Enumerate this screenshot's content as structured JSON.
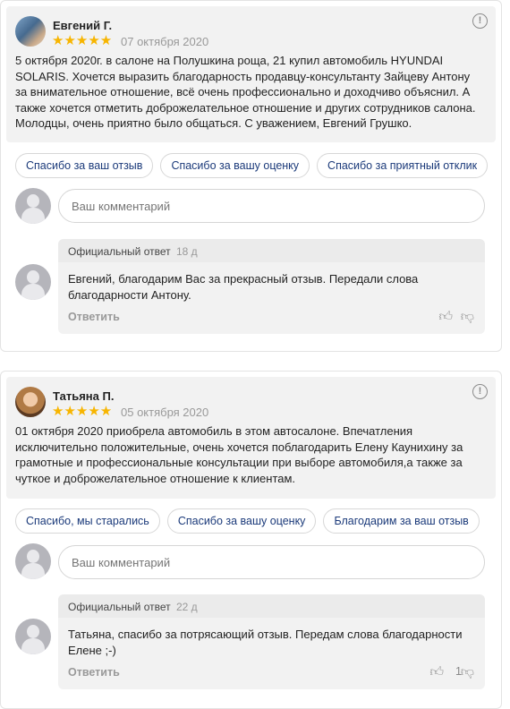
{
  "reviews": [
    {
      "author": "Евгений Г.",
      "rating": 5,
      "stars": "★★★★★",
      "date": "07 октября 2020",
      "text": "5 октября 2020г. в салоне на Полушкина роща, 21 купил автомобиль HYUNDAI SOLARIS. Хочется выразить благодарность продавцу-консультанту Зайцеву Антону за внимательное отношение, всё очень профессионально и доходчиво объяснил. А также хочется отметить доброжелательное отношение и других сотрудников салона. Молодцы, очень приятно было общаться. С уважением, Евгений Грушко.",
      "quick_replies": [
        "Спасибо за ваш отзыв",
        "Спасибо за вашу оценку",
        "Спасибо за приятный отклик"
      ],
      "comment_placeholder": "Ваш комментарий",
      "official_reply": {
        "title": "Официальный ответ",
        "age": "18 д",
        "text": "Евгений, благодарим Вас за прекрасный отзыв. Передали слова благодарности Антону.",
        "reply_label": "Ответить",
        "likes": ""
      }
    },
    {
      "author": "Татьяна П.",
      "rating": 5,
      "stars": "★★★★★",
      "date": "05 октября 2020",
      "text": "01 октября 2020 приобрела автомобиль в этом автосалоне. Впечатления исключительно положительные, очень хочется поблагодарить Елену Каунихину за грамотные и профессиональные консультации при выборе автомобиля,а также за чуткое и доброжелательное отношение к клиентам.",
      "quick_replies": [
        "Спасибо, мы старались",
        "Спасибо за вашу оценку",
        "Благодарим за ваш отзыв"
      ],
      "comment_placeholder": "Ваш комментарий",
      "official_reply": {
        "title": "Официальный ответ",
        "age": "22 д",
        "text": "Татьяна, спасибо за потрясающий отзыв. Передам слова благодарности Елене ;-)",
        "reply_label": "Ответить",
        "likes": "1"
      }
    }
  ],
  "icons": {
    "alert": "alert-icon",
    "thumb_up": "thumb-up-icon",
    "thumb_down": "thumb-down-icon",
    "user": "user-placeholder-icon",
    "star": "star-icon"
  },
  "colors": {
    "star": "#f7b500",
    "chip_text": "#1b3a7a",
    "panel_bg": "#f2f2f2"
  }
}
